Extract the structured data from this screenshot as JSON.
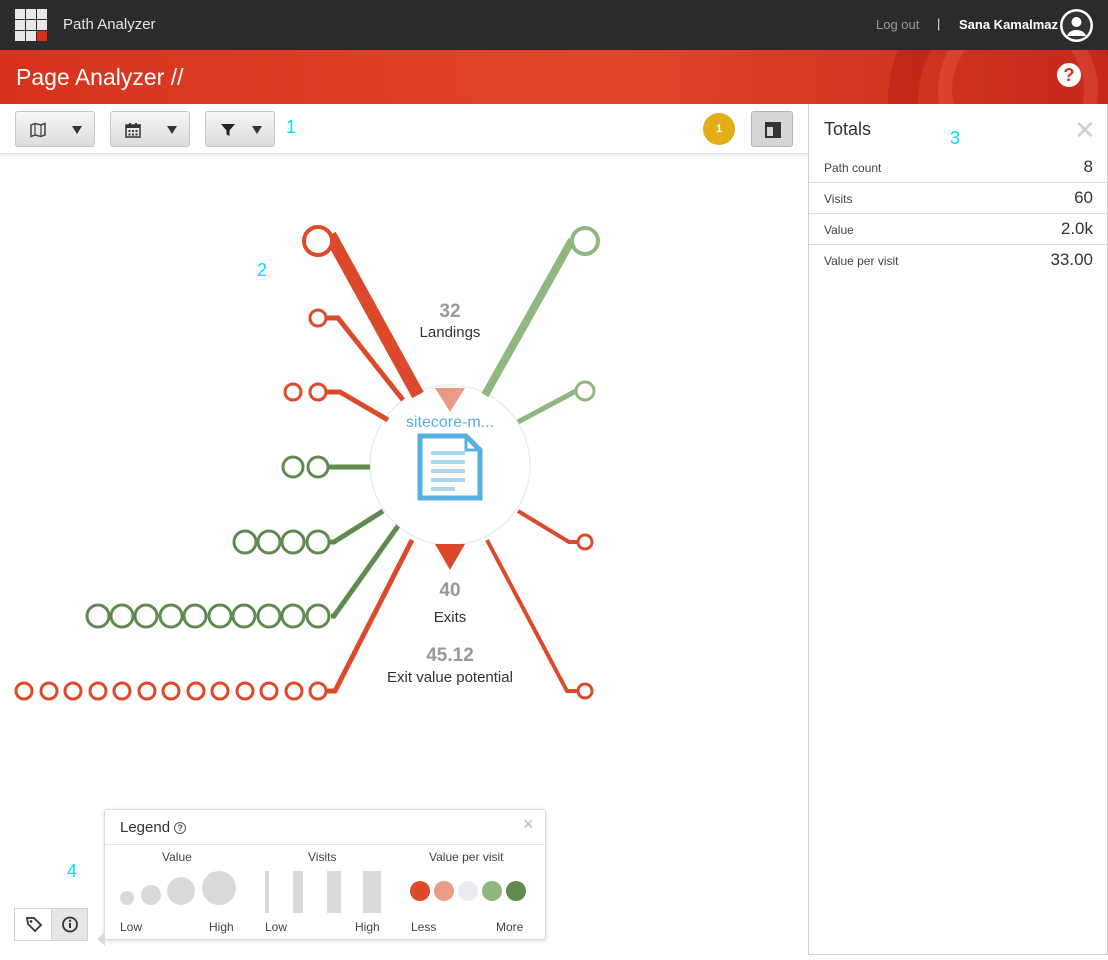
{
  "topbar": {
    "app_name": "Path Analyzer",
    "logout_label": "Log out",
    "separator": "|",
    "user_name": "Sana Kamalmaz"
  },
  "header": {
    "page_title": "Page Analyzer //",
    "help_label": "?"
  },
  "toolbar": {
    "buttons": [
      {
        "name": "map-dropdown",
        "icon": "map-icon"
      },
      {
        "name": "date-dropdown",
        "icon": "calendar-icon"
      },
      {
        "name": "filter-dropdown",
        "icon": "filter-icon"
      }
    ],
    "notification_count": "1",
    "panel_toggle_icon": "panel-layout-icon"
  },
  "annotations": {
    "a1": "1",
    "a2": "2",
    "a3": "3",
    "a4": "4"
  },
  "graph": {
    "center_label": "sitecore-m...",
    "center_icon": "document-icon",
    "landings": {
      "value": "32",
      "label": "Landings"
    },
    "exits": {
      "value": "40",
      "label": "Exits"
    },
    "exit_value_potential": {
      "value": "45.12",
      "label": "Exit value potential"
    },
    "colors": {
      "red": "#dc4a2b",
      "light_red": "#e99b86",
      "light_green": "#8fb77f",
      "dark_green": "#5f8a50",
      "node_blue": "#56b0de"
    }
  },
  "totals": {
    "title": "Totals",
    "close_label": "✕",
    "rows": [
      {
        "label": "Path count",
        "value": "8"
      },
      {
        "label": "Visits",
        "value": "60"
      },
      {
        "label": "Value",
        "value": "2.0k"
      },
      {
        "label": "Value per visit",
        "value": "33.00"
      }
    ]
  },
  "legend": {
    "title": "Legend",
    "help_label": "?",
    "close_label": "×",
    "value": {
      "heading": "Value",
      "low": "Low",
      "high": "High"
    },
    "visits": {
      "heading": "Visits",
      "low": "Low",
      "high": "High"
    },
    "value_per_visit": {
      "heading": "Value per visit",
      "low": "Less",
      "high": "More"
    },
    "vpv_colors": [
      "#dc4a2b",
      "#e99b86",
      "#ecebf2",
      "#8fb77f",
      "#5f8a50"
    ]
  },
  "bottom_buttons": [
    {
      "name": "tag-icon"
    },
    {
      "name": "info-icon"
    }
  ]
}
